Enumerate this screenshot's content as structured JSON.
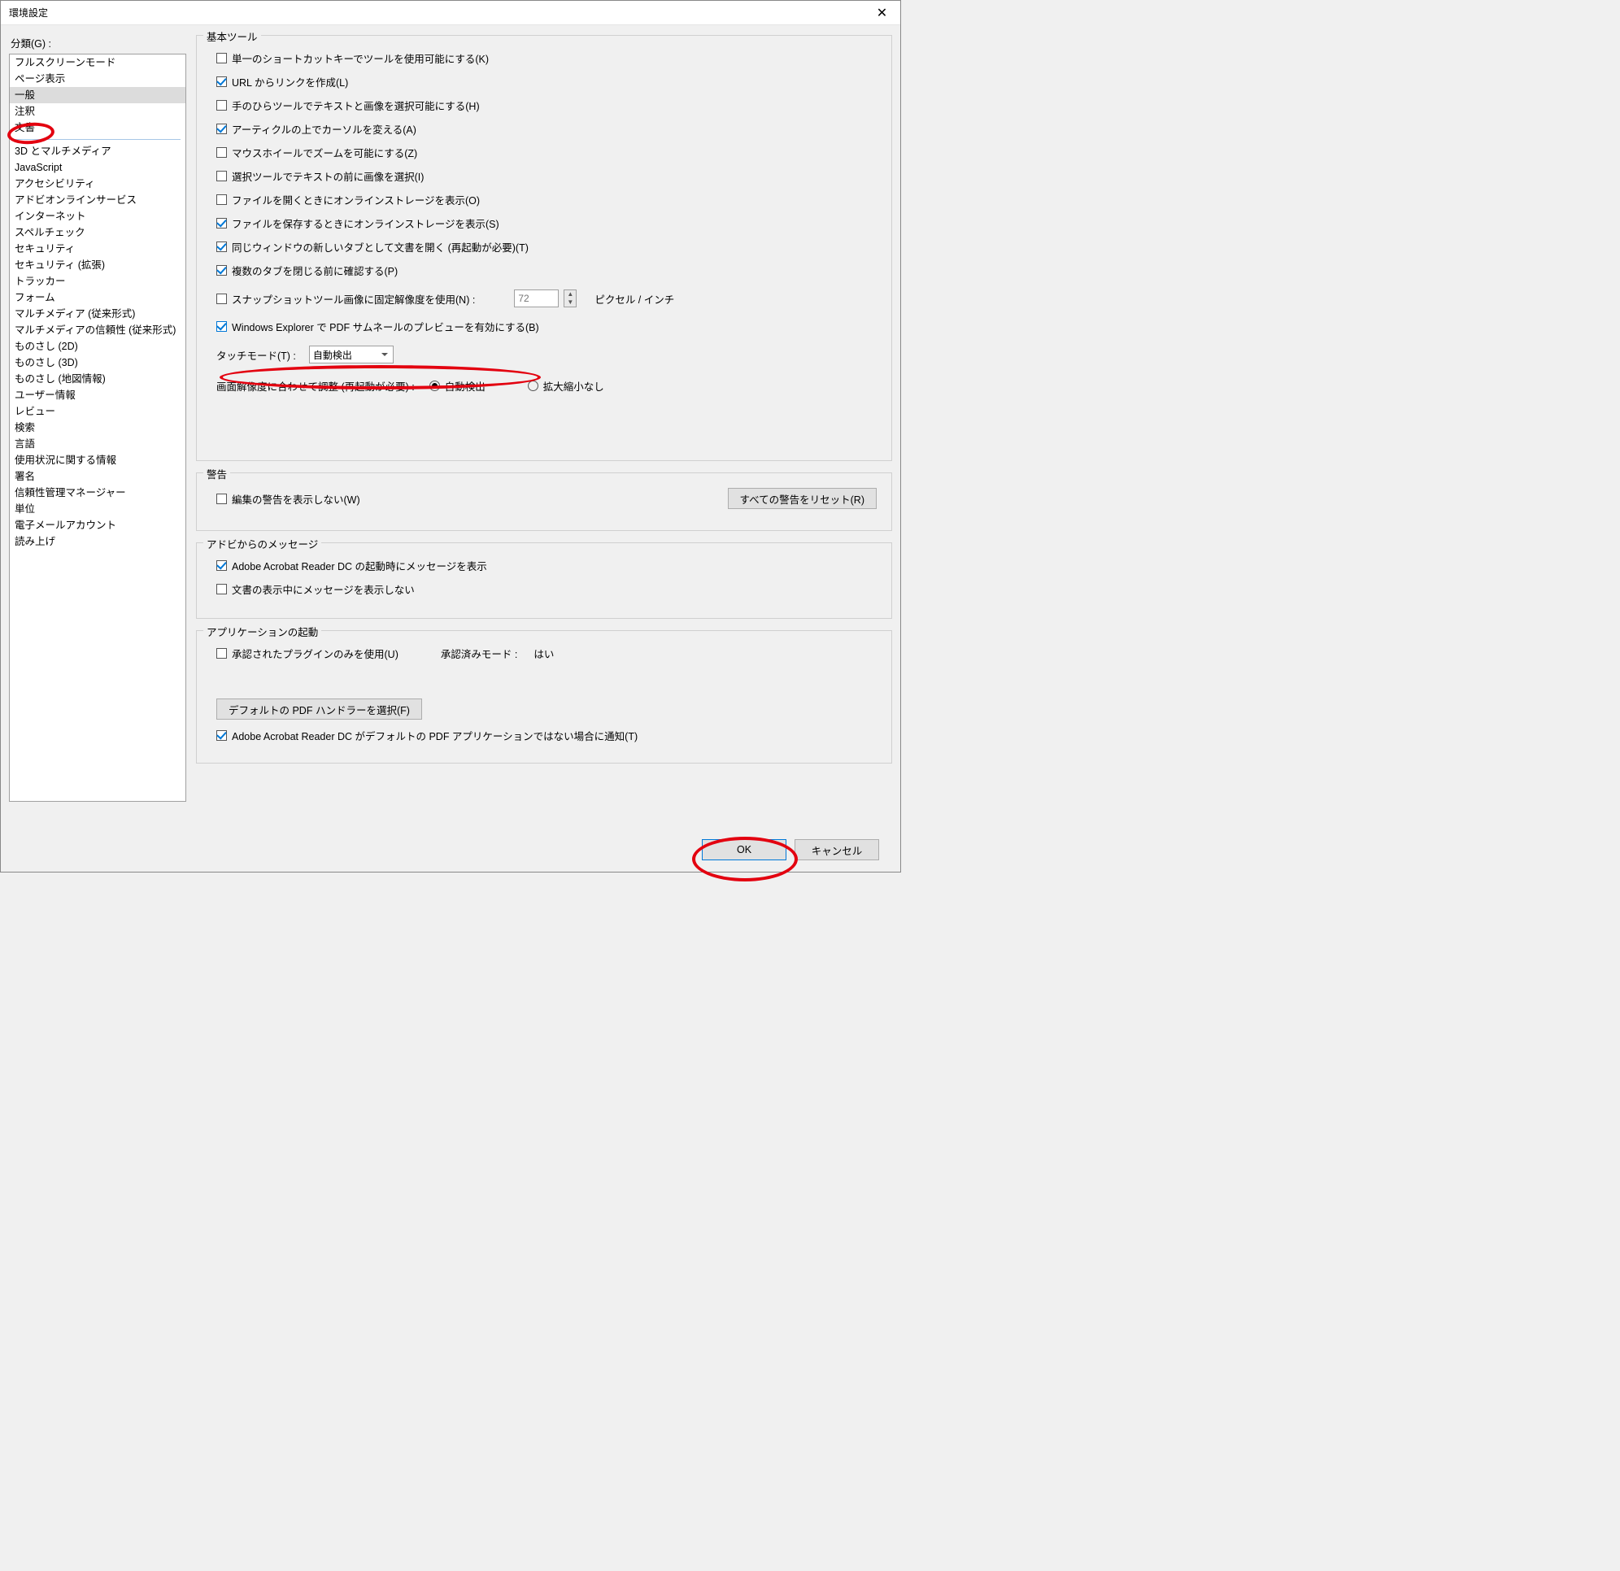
{
  "window": {
    "title": "環境設定"
  },
  "sidebar": {
    "label": "分類(G) :",
    "top_items": [
      "フルスクリーンモード",
      "ページ表示",
      "一般",
      "注釈",
      "文書"
    ],
    "selected_index": 2,
    "bottom_items": [
      "3D とマルチメディア",
      "JavaScript",
      "アクセシビリティ",
      "アドビオンラインサービス",
      "インターネット",
      "スペルチェック",
      "セキュリティ",
      "セキュリティ (拡張)",
      "トラッカー",
      "フォーム",
      "マルチメディア (従来形式)",
      "マルチメディアの信頼性 (従来形式)",
      "ものさし (2D)",
      "ものさし (3D)",
      "ものさし (地図情報)",
      "ユーザー情報",
      "レビュー",
      "検索",
      "言語",
      "使用状況に関する情報",
      "署名",
      "信頼性管理マネージャー",
      "単位",
      "電子メールアカウント",
      "読み上げ"
    ]
  },
  "basic": {
    "legend": "基本ツール",
    "c0": {
      "checked": false,
      "label": "単一のショートカットキーでツールを使用可能にする(K)"
    },
    "c1": {
      "checked": true,
      "label": "URL からリンクを作成(L)"
    },
    "c2": {
      "checked": false,
      "label": "手のひらツールでテキストと画像を選択可能にする(H)"
    },
    "c3": {
      "checked": true,
      "label": "アーティクルの上でカーソルを変える(A)"
    },
    "c4": {
      "checked": false,
      "label": "マウスホイールでズームを可能にする(Z)"
    },
    "c5": {
      "checked": false,
      "label": "選択ツールでテキストの前に画像を選択(I)"
    },
    "c6": {
      "checked": false,
      "label": "ファイルを開くときにオンラインストレージを表示(O)"
    },
    "c7": {
      "checked": true,
      "label": "ファイルを保存するときにオンラインストレージを表示(S)"
    },
    "c8": {
      "checked": true,
      "label": "同じウィンドウの新しいタブとして文書を開く (再起動が必要)(T)"
    },
    "c9": {
      "checked": true,
      "label": "複数のタブを閉じる前に確認する(P)"
    },
    "c10": {
      "checked": false,
      "label": "スナップショットツール画像に固定解像度を使用(N) :"
    },
    "snapshot_value": "72",
    "snapshot_unit": "ピクセル / インチ",
    "c11": {
      "checked": true,
      "label": "Windows Explorer で PDF サムネールのプレビューを有効にする(B)"
    },
    "touch_label": "タッチモード(T) :",
    "touch_value": "自動検出",
    "resolution_label": "画面解像度に合わせて調整 (再起動が必要) :",
    "resolution_opt1": "自動検出",
    "resolution_opt2": "拡大縮小なし"
  },
  "warnings": {
    "legend": "警告",
    "c0": {
      "checked": false,
      "label": "編集の警告を表示しない(W)"
    },
    "reset_button": "すべての警告をリセット(R)"
  },
  "messages": {
    "legend": "アドビからのメッセージ",
    "c0": {
      "checked": true,
      "label": "Adobe Acrobat Reader DC の起動時にメッセージを表示"
    },
    "c1": {
      "checked": false,
      "label": "文書の表示中にメッセージを表示しない"
    }
  },
  "startup": {
    "legend": "アプリケーションの起動",
    "c0": {
      "checked": false,
      "label": "承認されたプラグインのみを使用(U)"
    },
    "approved_label": "承認済みモード :",
    "approved_value": "はい",
    "default_handler_button": "デフォルトの PDF ハンドラーを選択(F)",
    "c1": {
      "checked": true,
      "label": "Adobe Acrobat Reader DC がデフォルトの PDF アプリケーションではない場合に通知(T)"
    }
  },
  "footer": {
    "ok": "OK",
    "cancel": "キャンセル"
  }
}
